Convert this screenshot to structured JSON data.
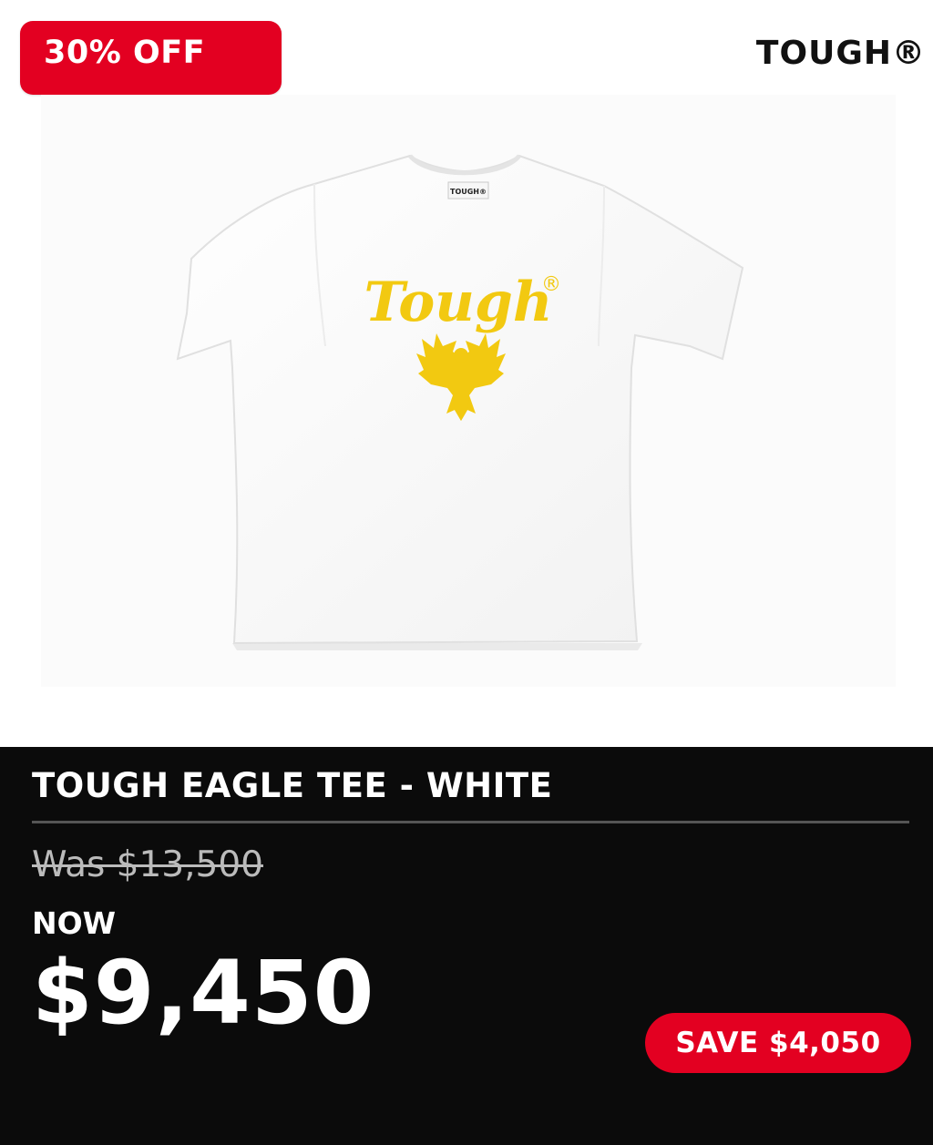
{
  "badge": {
    "discount_label": "30% OFF"
  },
  "header": {
    "brand": "TOUGH®"
  },
  "image": {
    "neck_label": "TOUGH®",
    "print_text": "Tough",
    "print_mark": "®",
    "icon": "eagle-icon"
  },
  "product": {
    "title": "TOUGH EAGLE TEE - WHITE",
    "was_price": "Was $13,500",
    "now_label": "NOW",
    "now_price": "$9,450",
    "save_label": "SAVE $4,050"
  },
  "colors": {
    "accent_red": "#e30021",
    "panel_black": "#0b0b0b",
    "print_yellow": "#f2c911",
    "strike_gray": "#bbbbbb"
  }
}
